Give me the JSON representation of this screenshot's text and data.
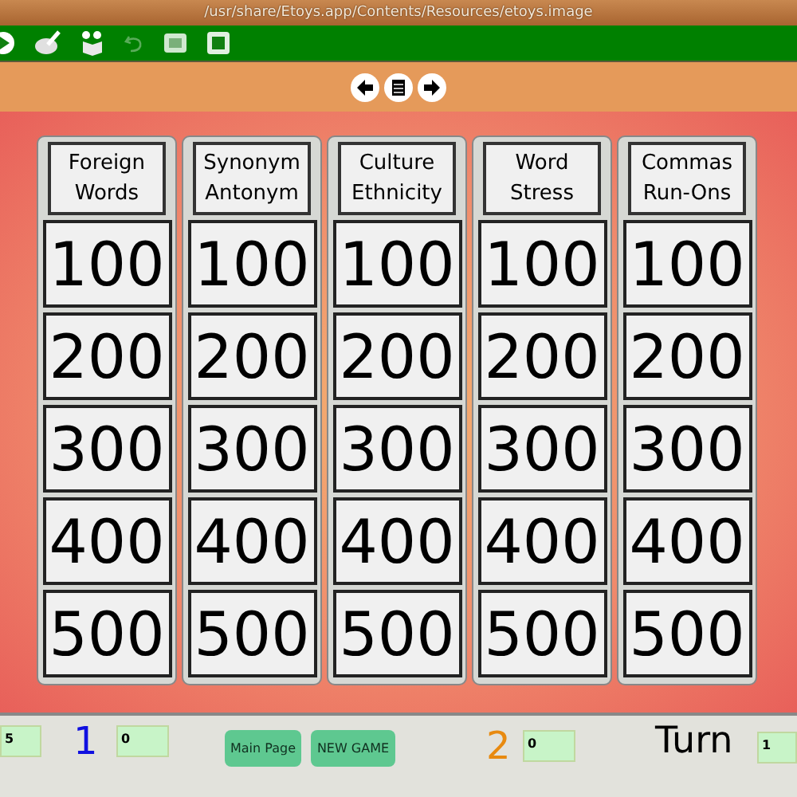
{
  "window": {
    "title": "/usr/share/Etoys.app/Contents/Resources/etoys.image"
  },
  "toolbar": [
    {
      "kind": "play",
      "disabled": false
    },
    {
      "kind": "paint",
      "disabled": false
    },
    {
      "kind": "supplies",
      "disabled": false
    },
    {
      "kind": "undo",
      "disabled": true
    },
    {
      "kind": "book",
      "disabled": false
    },
    {
      "kind": "fullscreen",
      "disabled": false
    }
  ],
  "nav": [
    {
      "kind": "prev"
    },
    {
      "kind": "menu"
    },
    {
      "kind": "next"
    }
  ],
  "board": {
    "columns": [
      {
        "title": "Foreign\nWords",
        "values": [
          "100",
          "200",
          "300",
          "400",
          "500"
        ]
      },
      {
        "title": "Synonym\nAntonym",
        "values": [
          "100",
          "200",
          "300",
          "400",
          "500"
        ]
      },
      {
        "title": "Culture\nEthnicity",
        "values": [
          "100",
          "200",
          "300",
          "400",
          "500"
        ]
      },
      {
        "title": "Word\nStress",
        "values": [
          "100",
          "200",
          "300",
          "400",
          "500"
        ]
      },
      {
        "title": "Commas\nRun-Ons",
        "values": [
          "100",
          "200",
          "300",
          "400",
          "500"
        ]
      }
    ]
  },
  "footer": {
    "score_field": "5",
    "team1": {
      "label": "1",
      "score": "0"
    },
    "buttons": [
      "Main Page",
      "NEW GAME"
    ],
    "team2": {
      "label": "2",
      "score": "0"
    },
    "turn": {
      "label": "Turn",
      "value": "1"
    }
  }
}
